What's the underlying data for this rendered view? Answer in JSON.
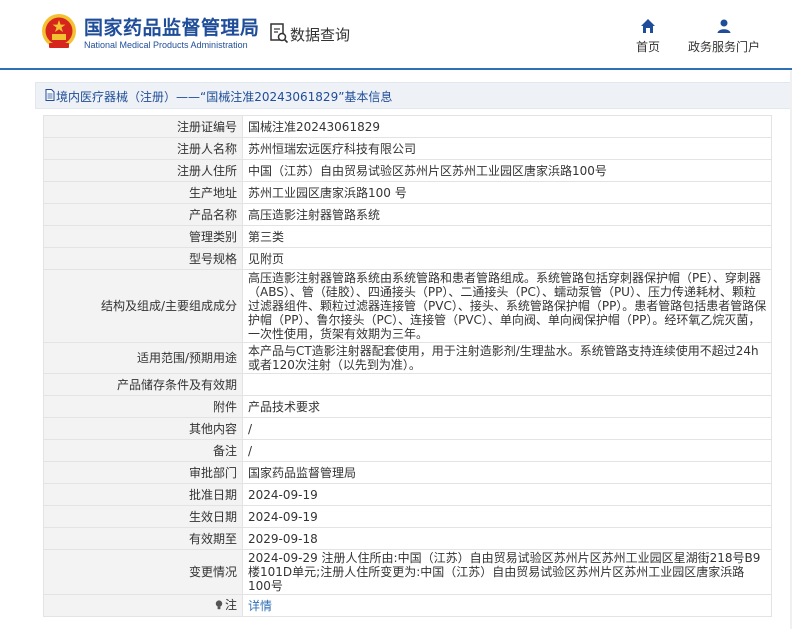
{
  "header": {
    "org_name_cn": "国家药品监督管理局",
    "org_name_en": "National Medical Products Administration",
    "query_label": "数据查询",
    "nav": [
      {
        "label": "首页",
        "icon": "home-icon"
      },
      {
        "label": "政务服务门户",
        "icon": "user-icon"
      }
    ]
  },
  "breadcrumb": {
    "text": "境内医疗器械（注册）——“国械注准20243061829”基本信息",
    "icon": "document-icon"
  },
  "record": {
    "rows": [
      {
        "label": "注册证编号",
        "value": "国械注准20243061829"
      },
      {
        "label": "注册人名称",
        "value": "苏州恒瑞宏远医疗科技有限公司"
      },
      {
        "label": "注册人住所",
        "value": "中国（江苏）自由贸易试验区苏州片区苏州工业园区唐家浜路100号"
      },
      {
        "label": "生产地址",
        "value": "苏州工业园区唐家浜路100 号"
      },
      {
        "label": "产品名称",
        "value": "高压造影注射器管路系统"
      },
      {
        "label": "管理类别",
        "value": "第三类"
      },
      {
        "label": "型号规格",
        "value": "见附页"
      },
      {
        "label": "结构及组成/主要组成成分",
        "value": "高压造影注射器管路系统由系统管路和患者管路组成。系统管路包括穿刺器保护帽（PE）、穿刺器（ABS）、管（硅胶）、四通接头（PP）、二通接头（PC）、蠕动泵管（PU）、压力传递耗材、颗粒过滤器组件、颗粒过滤器连接管（PVC）、接头、系统管路保护帽（PP）。患者管路包括患者管路保护帽（PP）、鲁尔接头（PC）、连接管（PVC）、单向阀、单向阀保护帽（PP）。经环氧乙烷灭菌，一次性使用，货架有效期为三年。"
      },
      {
        "label": "适用范围/预期用途",
        "value": "本产品与CT造影注射器配套使用，用于注射造影剂/生理盐水。系统管路支持连续使用不超过24h或者120次注射（以先到为准）。"
      },
      {
        "label": "产品储存条件及有效期",
        "value": ""
      },
      {
        "label": "附件",
        "value": "产品技术要求"
      },
      {
        "label": "其他内容",
        "value": "/"
      },
      {
        "label": "备注",
        "value": "/"
      },
      {
        "label": "审批部门",
        "value": "国家药品监督管理局"
      },
      {
        "label": "批准日期",
        "value": "2024-09-19"
      },
      {
        "label": "生效日期",
        "value": "2024-09-19"
      },
      {
        "label": "有效期至",
        "value": "2029-09-18"
      },
      {
        "label": "变更情况",
        "value": "2024-09-29 注册人住所由:中国（江苏）自由贸易试验区苏州片区苏州工业园区星湖街218号B9楼101D单元;注册人住所变更为:中国（江苏）自由贸易试验区苏州片区苏州工业园区唐家浜路100号"
      }
    ],
    "note": {
      "label": "注",
      "value": "详情",
      "icon": "bulb-icon"
    }
  },
  "colors": {
    "brand_blue": "#1f4d99",
    "link_blue": "#2f6fb5",
    "emblem_red": "#d6251c",
    "emblem_gold": "#f2c230"
  }
}
